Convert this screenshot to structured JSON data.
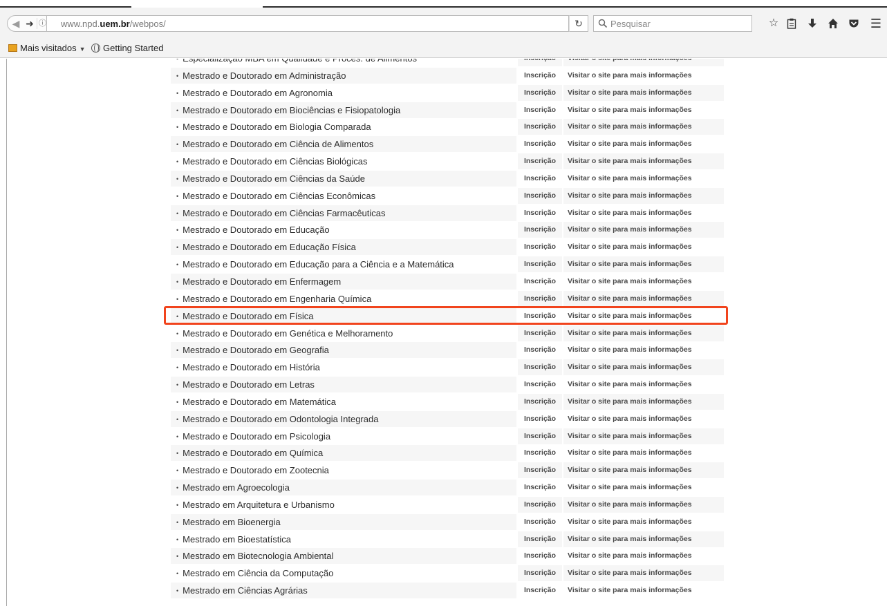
{
  "browser": {
    "url_host_prefix": "www.npd.",
    "url_host_domain": "uem.br",
    "url_path": "/webpos/",
    "search_placeholder": "Pesquisar",
    "icons": {
      "back": "back-arrow-icon",
      "forward": "forward-arrow-icon",
      "info": "info-icon",
      "reload": "reload-icon",
      "search": "magnifier-icon",
      "bookmark_star": "star-icon",
      "reading_list": "clipboard-icon",
      "downloads": "download-arrow-icon",
      "home": "home-icon",
      "pocket": "pocket-icon",
      "menu": "hamburger-menu-icon"
    }
  },
  "bookmarks": {
    "most_visited": "Mais visitados",
    "getting_started": "Getting Started"
  },
  "courses": {
    "inscricao_label": "Inscrição",
    "info_label": "Visitar o site para mais informações",
    "highlight_color": "#f1441d",
    "items": [
      "Especialização MBA em Qualidade e Proces. de Alimentos",
      "Mestrado e Doutorado em Administração",
      "Mestrado e Doutorado em Agronomia",
      "Mestrado e Doutorado em Biociências e Fisiopatologia",
      "Mestrado e Doutorado em Biologia Comparada",
      "Mestrado e Doutorado em Ciência de Alimentos",
      "Mestrado e Doutorado em Ciências Biológicas",
      "Mestrado e Doutorado em Ciências da Saúde",
      "Mestrado e Doutorado em Ciências Econômicas",
      "Mestrado e Doutorado em Ciências Farmacêuticas",
      "Mestrado e Doutorado em Educação",
      "Mestrado e Doutorado em Educação Física",
      "Mestrado e Doutorado em Educação para a Ciência e a Matemática",
      "Mestrado e Doutorado em Enfermagem",
      "Mestrado e Doutorado em Engenharia Química",
      "Mestrado e Doutorado em Física",
      "Mestrado e Doutorado em Genética e Melhoramento",
      "Mestrado e Doutorado em Geografia",
      "Mestrado e Doutorado em História",
      "Mestrado e Doutorado em Letras",
      "Mestrado e Doutorado em Matemática",
      "Mestrado e Doutorado em Odontologia Integrada",
      "Mestrado e Doutorado em Psicologia",
      "Mestrado e Doutorado em Química",
      "Mestrado e Doutorado em Zootecnia",
      "Mestrado em Agroecologia",
      "Mestrado em Arquitetura e Urbanismo",
      "Mestrado em Bioenergia",
      "Mestrado em Bioestatística",
      "Mestrado em Biotecnologia Ambiental",
      "Mestrado em Ciência da Computação",
      "Mestrado em Ciências Agrárias"
    ],
    "highlighted_item": "Mestrado e Doutorado em Física"
  }
}
